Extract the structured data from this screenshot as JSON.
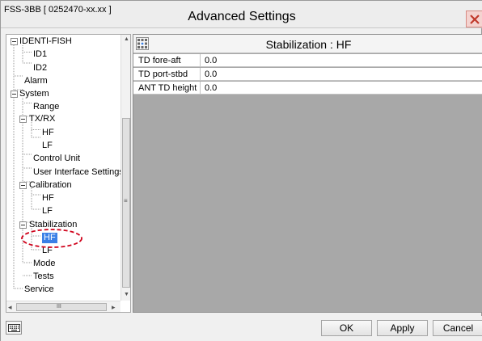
{
  "window": {
    "app_id": "FSS-3BB [ 0252470-xx.xx ]",
    "title": "Advanced Settings",
    "close_icon": "close-icon"
  },
  "tree": {
    "nodes": [
      {
        "label": "IDENTI-FISH",
        "expanded": true
      },
      {
        "label": "ID1"
      },
      {
        "label": "ID2"
      },
      {
        "label": "Alarm"
      },
      {
        "label": "System",
        "expanded": true
      },
      {
        "label": "Range"
      },
      {
        "label": "TX/RX",
        "expanded": true
      },
      {
        "label": "HF"
      },
      {
        "label": "LF"
      },
      {
        "label": "Control Unit"
      },
      {
        "label": "User Interface Settings"
      },
      {
        "label": "Calibration",
        "expanded": true
      },
      {
        "label": "HF"
      },
      {
        "label": "LF"
      },
      {
        "label": "Stabilization",
        "expanded": true
      },
      {
        "label": "HF",
        "selected": true
      },
      {
        "label": "LF"
      },
      {
        "label": "Mode"
      },
      {
        "label": "Tests"
      },
      {
        "label": "Service"
      }
    ],
    "scroll_glyphs": {
      "up": "▲",
      "down": "▼",
      "left": "◂",
      "right": "▸",
      "grip_v": "≡",
      "grip_h": "III"
    }
  },
  "panel": {
    "title": "Stabilization : HF",
    "header_icon": "settings-grid-icon",
    "rows": [
      {
        "label": "TD fore-aft",
        "value": "0.0"
      },
      {
        "label": "TD port-stbd",
        "value": "0.0"
      },
      {
        "label": "ANT TD height",
        "value": "0.0"
      }
    ]
  },
  "footer": {
    "keyboard_icon": "keyboard-icon",
    "ok_label": "OK",
    "apply_label": "Apply",
    "cancel_label": "Cancel"
  },
  "colors": {
    "selection": "#3b80e6",
    "highlight_circle": "#d0021b",
    "close_button": "#f4d3d0",
    "panel_background": "#a8a8a8"
  }
}
